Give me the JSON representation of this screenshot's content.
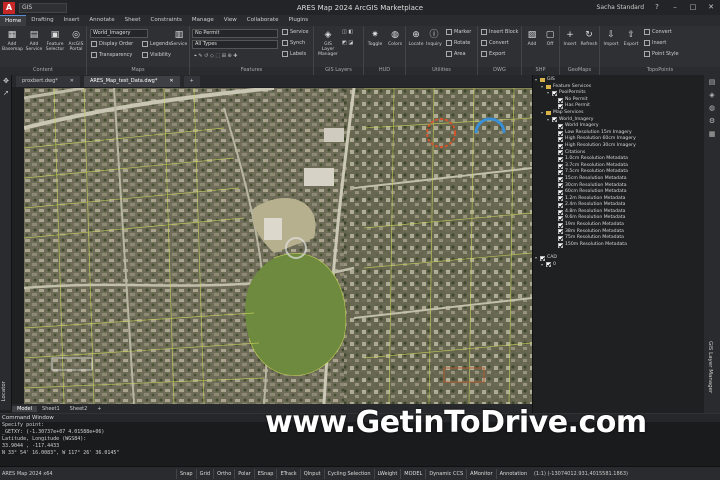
{
  "titlebar": {
    "quick_search": "GIS",
    "title": "ARES Map 2024  ArcGIS Marketplace",
    "user": "Sacha Standard"
  },
  "menu": [
    "Home",
    "Drafting",
    "Insert",
    "Annotate",
    "Sheet",
    "Constraints",
    "Manage",
    "View",
    "Collaborate",
    "Plugins"
  ],
  "ribbon": {
    "add_basemap": "Add Basemap",
    "add_service": "Add Service",
    "feature_selector": "Feature Selector",
    "arcgis_portal": "ArcGIS Portal",
    "group_content": "Content",
    "basemap_value": "World_Imagery",
    "display_order": "Display Order",
    "transparency": "Transparency",
    "legends": "Legends",
    "visibility": "Visibility",
    "service": "Service",
    "group_maps": "Maps",
    "no_permit": "No Permit",
    "all_types": "All Types",
    "service2": "Service",
    "synch": "Synch",
    "labels": "Labels",
    "group_features": "Features",
    "gis_layer_manager": "GIS Layer Manager",
    "group_gis_layers": "GIS Layers",
    "toggle": "Toggle",
    "colors": "Colors",
    "group_hud": "HUD",
    "locate": "Locate",
    "inquiry": "Inquiry",
    "marker": "Marker",
    "rotate": "Rotate",
    "area": "Area",
    "group_utilities": "Utilities",
    "insert_block": "Insert Block",
    "convert": "Convert",
    "export": "Export",
    "group_dwg": "DWG",
    "add": "Add",
    "off": "Off",
    "group_shp": "SHP",
    "insert": "Insert",
    "refresh": "Refresh",
    "group_geomaps": "GeoMaps",
    "import": "Import",
    "export2": "Export",
    "convert2": "Convert",
    "insert2": "Insert",
    "point_style": "Point Style",
    "group_topopoints": "TopoPoints"
  },
  "doc_tabs": [
    "proxbert.dwg*",
    "ARES_Map_test_Data.dwg*"
  ],
  "layout_tabs": [
    "Model",
    "Sheet1",
    "Sheet2"
  ],
  "left_panel_label": "Locator",
  "right_panel_label": "GIS Layer Manager",
  "gis_tree": [
    {
      "label": "GIS",
      "depth": 0,
      "kind": "expand"
    },
    {
      "label": "Feature Services",
      "depth": 1,
      "kind": "expand"
    },
    {
      "label": "PoolPermits",
      "depth": 2,
      "kind": "check"
    },
    {
      "label": "No Permit",
      "depth": 3,
      "kind": "check"
    },
    {
      "label": "Has Permit",
      "depth": 3,
      "kind": "check"
    },
    {
      "label": "Map Services",
      "depth": 1,
      "kind": "expand"
    },
    {
      "label": "World_Imagery",
      "depth": 2,
      "kind": "check"
    },
    {
      "label": "World Imagery",
      "depth": 3,
      "kind": "check"
    },
    {
      "label": "Low Resolution 15m Imagery",
      "depth": 3,
      "kind": "check"
    },
    {
      "label": "High Resolution 60cm Imagery",
      "depth": 3,
      "kind": "check"
    },
    {
      "label": "High Resolution 30cm Imagery",
      "depth": 3,
      "kind": "check"
    },
    {
      "label": "Citations",
      "depth": 3,
      "kind": "check"
    },
    {
      "label": "1.0cm Resolution Metadata",
      "depth": 3,
      "kind": "check"
    },
    {
      "label": "3.7cm Resolution Metadata",
      "depth": 3,
      "kind": "check"
    },
    {
      "label": "7.5cm Resolution Metadata",
      "depth": 3,
      "kind": "check"
    },
    {
      "label": "15cm Resolution Metadata",
      "depth": 3,
      "kind": "check"
    },
    {
      "label": "30cm Resolution Metadata",
      "depth": 3,
      "kind": "check"
    },
    {
      "label": "60cm Resolution Metadata",
      "depth": 3,
      "kind": "check"
    },
    {
      "label": "1.2m Resolution Metadata",
      "depth": 3,
      "kind": "check"
    },
    {
      "label": "2.4m Resolution Metadata",
      "depth": 3,
      "kind": "check"
    },
    {
      "label": "4.8m Resolution Metadata",
      "depth": 3,
      "kind": "check"
    },
    {
      "label": "9.6m Resolution Metadata",
      "depth": 3,
      "kind": "check"
    },
    {
      "label": "19m Resolution Metadata",
      "depth": 3,
      "kind": "check"
    },
    {
      "label": "38m Resolution Metadata",
      "depth": 3,
      "kind": "check"
    },
    {
      "label": "75m Resolution Metadata",
      "depth": 3,
      "kind": "check"
    },
    {
      "label": "150m Resolution Metadata",
      "depth": 3,
      "kind": "check"
    },
    {
      "label": "",
      "depth": 0,
      "kind": "spacer"
    },
    {
      "label": "CAD",
      "depth": 0,
      "kind": "check"
    },
    {
      "label": "0",
      "depth": 1,
      "kind": "check"
    }
  ],
  "command_window": {
    "title": "Command Window",
    "lines": [
      "Specify point:",
      "_GETXY: (-1.30737e+07 4.01588e+06)",
      "Latitude, Longitude (WGS84):",
      "33.9044 , -117.4433",
      "N 33° 54' 16.0083\", W 117° 26' 36.0145\""
    ]
  },
  "status": {
    "app": "ARES Map 2024 x64",
    "toggles": [
      "Snap",
      "Grid",
      "Ortho",
      "Polar",
      "ESnap",
      "ETrack",
      "QInput",
      "Cycling Selection",
      "LWeight",
      "MODEL",
      "Dynamic CCS",
      "AMonitor",
      "Annotation"
    ],
    "coords": "(1:1)  (-13074012.931,4015581.1863)"
  },
  "watermark": "www.GetinToDrive.com"
}
